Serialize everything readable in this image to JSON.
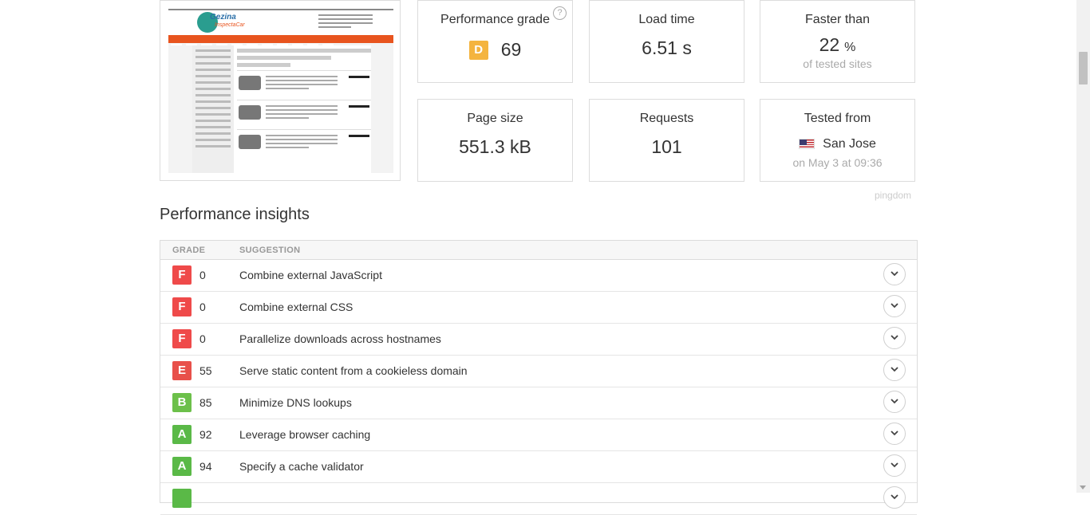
{
  "summary": {
    "performance_grade": {
      "title": "Performance grade",
      "letter": "D",
      "value": "69",
      "letter_color": "#f4b43f"
    },
    "load_time": {
      "title": "Load time",
      "value": "6.51 s"
    },
    "faster_than": {
      "title": "Faster than",
      "value": "22",
      "unit": "%",
      "sub": "of tested sites"
    },
    "page_size": {
      "title": "Page size",
      "value": "551.3 kB"
    },
    "requests": {
      "title": "Requests",
      "value": "101"
    },
    "tested_from": {
      "title": "Tested from",
      "location": "San Jose",
      "sub": "on May 3 at 09:36",
      "flag_icon": "us-flag-icon"
    },
    "help_glyph": "?"
  },
  "thumbnail": {
    "logo_text": "Gezina",
    "logo_text2": "InspectaCar"
  },
  "brand": "pingdom",
  "insights": {
    "title": "Performance insights",
    "col_grade": "GRADE",
    "col_suggestion": "SUGGESTION",
    "rows": [
      {
        "grade": "F",
        "score": "0",
        "suggestion": "Combine external JavaScript",
        "color": "#ef4a4a"
      },
      {
        "grade": "F",
        "score": "0",
        "suggestion": "Combine external CSS",
        "color": "#ef4a4a"
      },
      {
        "grade": "F",
        "score": "0",
        "suggestion": "Parallelize downloads across hostnames",
        "color": "#ef4a4a"
      },
      {
        "grade": "E",
        "score": "55",
        "suggestion": "Serve static content from a cookieless domain",
        "color": "#e8504a"
      },
      {
        "grade": "B",
        "score": "85",
        "suggestion": "Minimize DNS lookups",
        "color": "#6cc04a"
      },
      {
        "grade": "A",
        "score": "92",
        "suggestion": "Leverage browser caching",
        "color": "#5ab947"
      },
      {
        "grade": "A",
        "score": "94",
        "suggestion": "Specify a cache validator",
        "color": "#5ab947"
      },
      {
        "grade": "",
        "score": "",
        "suggestion": "",
        "color": "#5ab947"
      }
    ]
  },
  "icons": {
    "expand": "chevron-down-icon"
  }
}
